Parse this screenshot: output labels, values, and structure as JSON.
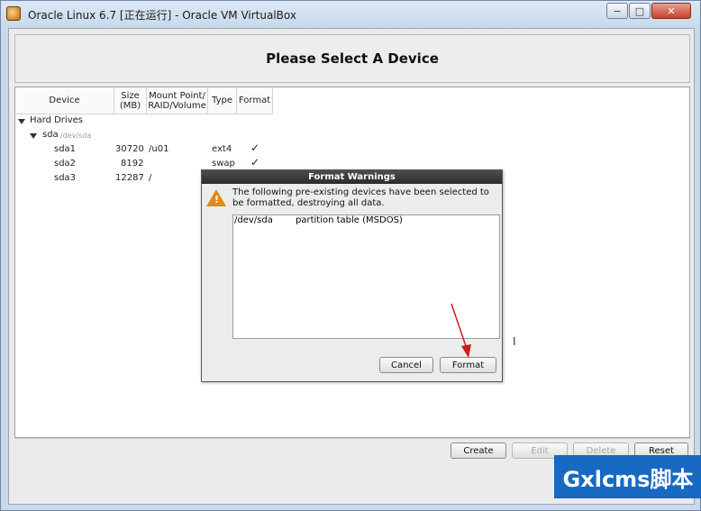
{
  "window": {
    "title": "Oracle Linux 6.7 [正在运行] - Oracle VM VirtualBox",
    "minimize_glyph": "−",
    "maximize_glyph": "□",
    "close_glyph": "✕"
  },
  "header": {
    "title": "Please Select A Device"
  },
  "tree": {
    "columns": [
      "Device",
      "Size\n(MB)",
      "Mount Point/\nRAID/Volume",
      "Type",
      "Format"
    ],
    "group": "Hard Drives",
    "disk": {
      "name": "sda",
      "path": "/dev/sda"
    },
    "partitions": [
      {
        "name": "sda1",
        "size": "30720",
        "mount": "/u01",
        "type": "ext4",
        "formatted": "✓"
      },
      {
        "name": "sda2",
        "size": "8192",
        "mount": "",
        "type": "swap",
        "formatted": "✓"
      },
      {
        "name": "sda3",
        "size": "12287",
        "mount": "/",
        "type": "",
        "formatted": ""
      }
    ]
  },
  "buttons": {
    "create": "Create",
    "edit": "Edit",
    "delete": "Delete",
    "reset": "Reset"
  },
  "dialog": {
    "title": "Format Warnings",
    "message": "The following pre-existing devices have been selected to be formatted, destroying all data.",
    "items": [
      {
        "device": "/dev/sda",
        "description": "partition table (MSDOS)"
      }
    ],
    "cancel": "Cancel",
    "format": "Format",
    "warning_mark": "!",
    "cursor_glyph": "I"
  },
  "watermark": {
    "text": "Gxlcms脚本"
  },
  "icons": {
    "app": "virtualbox-icon",
    "warning": "warning-icon"
  },
  "colors": {
    "warning": "#e08a12",
    "annotation": "#d11a1a",
    "watermark_bg": "#1769c2"
  }
}
